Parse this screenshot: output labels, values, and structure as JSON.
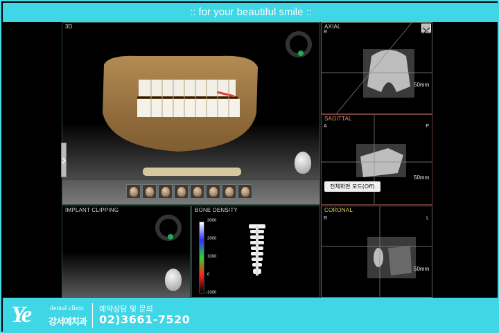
{
  "header": {
    "tagline": ":: for your beautiful smile ::"
  },
  "panels": {
    "view3d": {
      "label": "3D"
    },
    "axial": {
      "label": "AXIAL",
      "left": "R",
      "right": "L",
      "scale": "50mm"
    },
    "sagittal": {
      "label": "SAGITTAL",
      "left": "A",
      "right": "P",
      "scale": "50mm",
      "fullscreen_tooltip": "전체화면 모드(Off)"
    },
    "coronal": {
      "label": "CORONAL",
      "left": "R",
      "right": "L",
      "scale": "50mm"
    },
    "implant_clipping": {
      "label": "IMPLANT CLIPPING"
    },
    "bone_density": {
      "label": "BONE DENSITY",
      "scale_values": [
        "3000",
        "2000",
        "1000",
        "0",
        "-1000"
      ]
    }
  },
  "colors": {
    "accent": "#3fd6e6",
    "orientation_dot": "#1fae55"
  },
  "footer": {
    "logo_mark": "Ye",
    "logo_tagline": "dental clinic",
    "clinic_name": "강서예치과",
    "contact_label": "예약상담 및 문의",
    "phone": "02)3661-7520"
  }
}
